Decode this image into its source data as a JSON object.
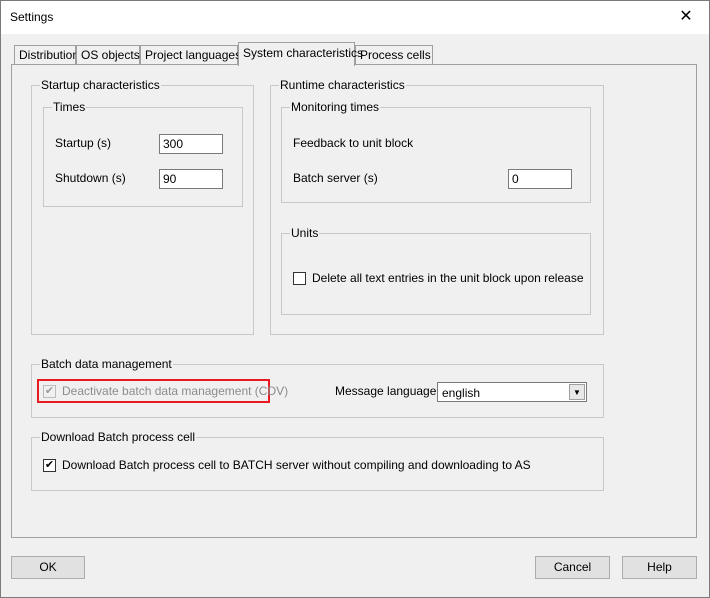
{
  "window": {
    "title": "Settings",
    "close_glyph": "✕"
  },
  "tabs": [
    {
      "label": "Distribution"
    },
    {
      "label": "OS objects"
    },
    {
      "label": "Project languages"
    },
    {
      "label": "System characteristics"
    },
    {
      "label": "Process cells"
    }
  ],
  "active_tab": "System characteristics",
  "startup": {
    "group_label": "Startup characteristics",
    "times_label": "Times",
    "startup_label": "Startup (s)",
    "startup_value": "300",
    "shutdown_label": "Shutdown (s)",
    "shutdown_value": "90"
  },
  "runtime": {
    "group_label": "Runtime characteristics",
    "monitoring_label": "Monitoring times",
    "feedback_label": "Feedback to unit block",
    "batch_server_label": "Batch server (s)",
    "batch_server_value": "0",
    "units_label": "Units",
    "delete_entries_label": "Delete all text entries in the unit block upon release",
    "delete_entries_checked": false
  },
  "batch_data": {
    "group_label": "Batch data management",
    "deactivate_label": "Deactivate batch data management (CDV)",
    "deactivate_checked": true,
    "deactivate_enabled": false,
    "message_language_label": "Message language",
    "message_language_value": "english",
    "highlight_color": "#e8191f"
  },
  "download": {
    "group_label": "Download Batch process cell",
    "download_label": "Download Batch process cell to BATCH server without compiling and downloading to AS",
    "download_checked": true,
    "check_glyph": "✔"
  },
  "buttons": {
    "ok": "OK",
    "cancel": "Cancel",
    "help": "Help"
  }
}
